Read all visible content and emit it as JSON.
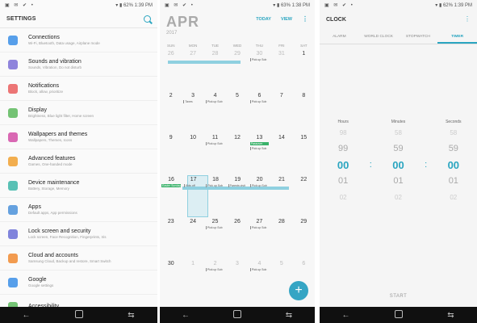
{
  "status": {
    "time1": "1:39 PM",
    "time2": "1:38 PM",
    "time3": "1:39 PM",
    "battery": "62%",
    "battery2": "63%"
  },
  "settings": {
    "title": "SETTINGS",
    "items": [
      {
        "name": "Connections",
        "sub": "Wi-Fi, Bluetooth, Data usage, Airplane mode",
        "color": "#3a8ee6"
      },
      {
        "name": "Sounds and vibration",
        "sub": "Sounds, Vibration, Do not disturb",
        "color": "#7b6fd6"
      },
      {
        "name": "Notifications",
        "sub": "Block, allow, prioritize",
        "color": "#e95d5d"
      },
      {
        "name": "Display",
        "sub": "Brightness, Blue light filter, Home screen",
        "color": "#5cb85c"
      },
      {
        "name": "Wallpapers and themes",
        "sub": "Wallpapers, Themes, Icons",
        "color": "#d24ea6"
      },
      {
        "name": "Advanced features",
        "sub": "Games, One-handed mode",
        "color": "#f0a030"
      },
      {
        "name": "Device maintenance",
        "sub": "Battery, Storage, Memory",
        "color": "#3cb6a8"
      },
      {
        "name": "Apps",
        "sub": "Default apps, App permissions",
        "color": "#4a90d9"
      },
      {
        "name": "Lock screen and security",
        "sub": "Lock screen, Face Recognition, Fingerprints, Iris",
        "color": "#6a6fd6"
      },
      {
        "name": "Cloud and accounts",
        "sub": "Samsung Cloud, Backup and restore, Smart Switch",
        "color": "#f08a30"
      },
      {
        "name": "Google",
        "sub": "Google settings",
        "color": "#3a8ee6"
      },
      {
        "name": "Accessibility",
        "sub": "",
        "color": "#5cb85c"
      }
    ]
  },
  "calendar": {
    "month": "APR",
    "year": "2017",
    "today_label": "TODAY",
    "view_label": "VIEW",
    "weekdays": [
      "SUN",
      "MON",
      "TUE",
      "WED",
      "THU",
      "FRI",
      "SAT"
    ],
    "rows": [
      [
        {
          "d": "26",
          "dim": true
        },
        {
          "d": "27",
          "dim": true
        },
        {
          "d": "28",
          "dim": true
        },
        {
          "d": "29",
          "dim": true
        },
        {
          "d": "30",
          "dim": true,
          "ev": "Pick up Sob"
        },
        {
          "d": "31",
          "dim": true
        },
        {
          "d": "1"
        }
      ],
      [
        {
          "d": "2"
        },
        {
          "d": "3",
          "ev": "Taxes"
        },
        {
          "d": "4",
          "ev": "Pick up Sob"
        },
        {
          "d": "5"
        },
        {
          "d": "6",
          "ev": "Pick up Sob"
        },
        {
          "d": "7"
        },
        {
          "d": "8"
        }
      ],
      [
        {
          "d": "9"
        },
        {
          "d": "10"
        },
        {
          "d": "11",
          "ev": "Pick up Sob"
        },
        {
          "d": "12"
        },
        {
          "d": "13",
          "ev": "Passover",
          "green": true,
          "ev2": "Pick up Sob"
        },
        {
          "d": "14"
        },
        {
          "d": "15"
        }
      ],
      [
        {
          "d": "16",
          "ev": "Easter Sunday",
          "green": true
        },
        {
          "d": "17",
          "ev": "Kids off"
        },
        {
          "d": "18",
          "ev": "Pick up Sob"
        },
        {
          "d": "19",
          "ev": "Parents visit"
        },
        {
          "d": "20",
          "ev": "Pick up Sob"
        },
        {
          "d": "21"
        },
        {
          "d": "22"
        }
      ],
      [
        {
          "d": "23"
        },
        {
          "d": "24"
        },
        {
          "d": "25",
          "ev": "Pick up Sob"
        },
        {
          "d": "26"
        },
        {
          "d": "27",
          "ev": "Pick up Sob"
        },
        {
          "d": "28"
        },
        {
          "d": "29"
        }
      ],
      [
        {
          "d": "30"
        },
        {
          "d": "1",
          "dim": true
        },
        {
          "d": "2",
          "dim": true,
          "ev": "Pick up Sob"
        },
        {
          "d": "3",
          "dim": true
        },
        {
          "d": "4",
          "dim": true,
          "ev": "Pick up Sob"
        },
        {
          "d": "5",
          "dim": true
        },
        {
          "d": "6",
          "dim": true
        }
      ]
    ],
    "fab": "+"
  },
  "clock": {
    "title": "CLOCK",
    "tabs": [
      "ALARM",
      "WORLD CLOCK",
      "STOPWATCH",
      "TIMER"
    ],
    "labels": [
      "Hours",
      "Minutes",
      "Seconds"
    ],
    "rows": [
      [
        "98",
        "58",
        "58"
      ],
      [
        "99",
        "59",
        "59"
      ],
      [
        "00",
        "00",
        "00"
      ],
      [
        "01",
        "01",
        "01"
      ],
      [
        "02",
        "02",
        "02"
      ]
    ],
    "start": "START"
  },
  "nav": {
    "back": "←",
    "recent": "⇆"
  }
}
